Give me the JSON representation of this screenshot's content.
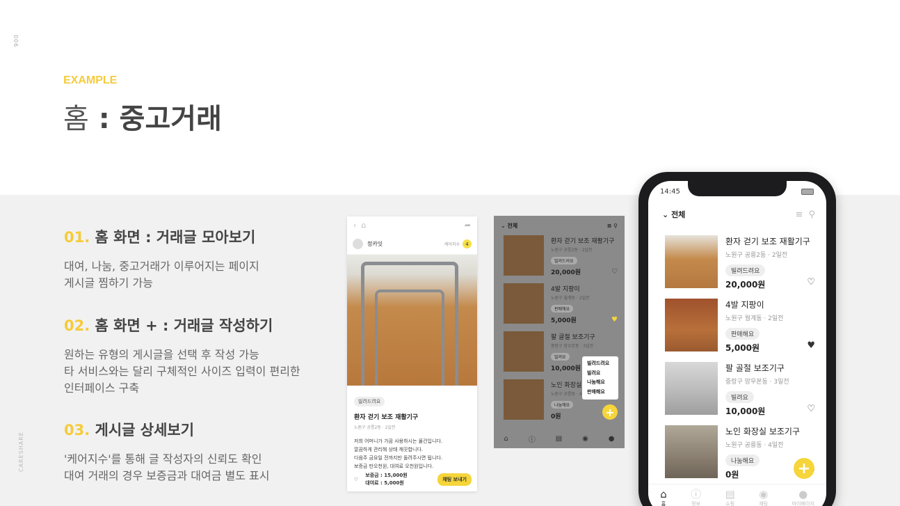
{
  "page_number": "006",
  "brand": "CARESHARE",
  "eyebrow": "EXAMPLE",
  "title": {
    "light": "홈",
    "sep": " : ",
    "bold": "중고거래"
  },
  "sections": [
    {
      "num": "01.",
      "heading": "홈 화면 : 거래글 모아보기",
      "lines": [
        "대여, 나눔, 중고거래가 이루어지는 페이지",
        "게시글 찜하기 가능"
      ]
    },
    {
      "num": "02.",
      "heading": "홈 화면 + : 거래글 작성하기",
      "lines": [
        "원하는 유형의 게시글을 선택 후 작성 가능",
        "타 서비스와는 달리 구체적인 사이즈 입력이 편리한",
        "인터페이스 구축"
      ]
    },
    {
      "num": "03.",
      "heading": "게시글 상세보기",
      "lines": [
        "'케어지수'를 통해 글 작성자의 신뢰도 확인",
        "대여 거래의 경우 보증금과 대여금 별도 표시"
      ]
    }
  ],
  "detail": {
    "user": "정카잇",
    "care_label": "케어지수",
    "care_value": "4",
    "tag": "빌려드려요",
    "title": "환자 걷기 보조 재활기구",
    "meta": "노원구 공릉2동 · 2일전",
    "desc": [
      "저희 어머니가 가끔 사용하시는 물건입니다.",
      "깔끔하게 관리해 상태 깨끗합니다.",
      "다음주 금요일 전까지만 돌려주시면 됩니다.",
      "보증금 만오천원, 대여료 오천원입니다."
    ],
    "deposit": "보증금 : 15,000원",
    "fee": "대여료 : 5,000원",
    "chat_button": "채팅 보내기"
  },
  "write": {
    "filter": "전체",
    "menu": [
      "빌려드려요",
      "빌려요",
      "나눔해요",
      "판매해요"
    ]
  },
  "phone": {
    "time": "14:45",
    "filter": "전체",
    "items": [
      {
        "name": "환자 걷기 보조 재활기구",
        "meta": "노원구 공릉2동 · 2일전",
        "tag": "빌려드려요",
        "price": "20,000원",
        "liked": false
      },
      {
        "name": "4발 지팡이",
        "meta": "노원구 월계동 · 2일전",
        "tag": "판매해요",
        "price": "5,000원",
        "liked": true
      },
      {
        "name": "팔 골절 보조기구",
        "meta": "중랑구 망우본동 · 3일전",
        "tag": "빌려요",
        "price": "10,000원",
        "liked": false
      },
      {
        "name": "노인 화장실 보조기구",
        "meta": "노원구 공릉동 · 4일전",
        "tag": "나눔해요",
        "price": "0원",
        "liked": false
      }
    ],
    "nav": [
      "홈",
      "정보",
      "쇼핑",
      "채팅",
      "마이페이지"
    ]
  },
  "colors": {
    "accent": "#f5cb3b",
    "like": "#f5d53a"
  }
}
